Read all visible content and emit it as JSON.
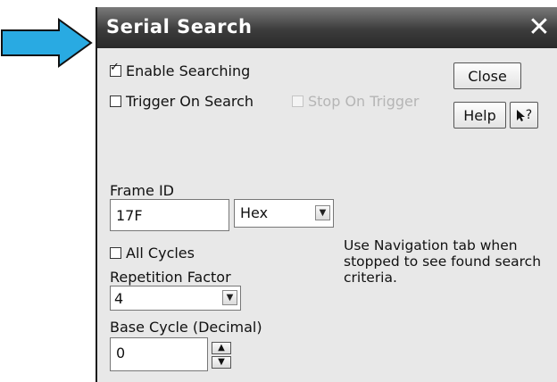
{
  "window": {
    "title": "Serial Search",
    "close_glyph": "✕"
  },
  "options": {
    "enable_searching": {
      "label": "Enable Searching",
      "checked": true
    },
    "trigger_on_search": {
      "label": "Trigger On Search",
      "checked": false
    },
    "stop_on_trigger": {
      "label": "Stop On Trigger",
      "checked": false,
      "disabled": true
    }
  },
  "buttons": {
    "close": "Close",
    "help": "Help",
    "whats_this_glyph": "?"
  },
  "frame_id": {
    "label": "Frame ID",
    "value": "17F",
    "format": "Hex"
  },
  "all_cycles": {
    "label": "All Cycles",
    "checked": false
  },
  "repetition_factor": {
    "label": "Repetition Factor",
    "value": "4"
  },
  "base_cycle": {
    "label": "Base Cycle (Decimal)",
    "value": "0"
  },
  "info_text": "Use Navigation tab when stopped to see found search criteria.",
  "colors": {
    "arrow": "#29aae2",
    "titlebar": "#3c3c3c",
    "dialog_bg": "#e8e8e8"
  },
  "icons": {
    "pointer": "arrow-pointer-icon",
    "arrow": "right-arrow-icon"
  }
}
